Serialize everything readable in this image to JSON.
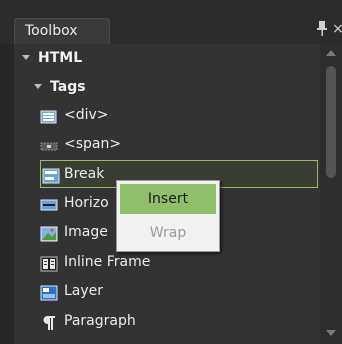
{
  "panel": {
    "tab_title": "Toolbox",
    "pin_icon": "pin-icon",
    "close_symbol": "×"
  },
  "tree": {
    "root": {
      "label": "HTML"
    },
    "group": {
      "label": "Tags"
    },
    "items": [
      {
        "label": "<div>",
        "icon": "div-icon"
      },
      {
        "label": "<span>",
        "icon": "span-icon"
      },
      {
        "label": "Break",
        "icon": "break-icon",
        "selected": true
      },
      {
        "label": "Horizo",
        "icon": "horizontal-rule-icon"
      },
      {
        "label": "Image",
        "icon": "image-icon"
      },
      {
        "label": "Inline Frame",
        "icon": "inline-frame-icon"
      },
      {
        "label": "Layer",
        "icon": "layer-icon"
      },
      {
        "label": "Paragraph",
        "icon": "paragraph-icon"
      }
    ]
  },
  "context_menu": {
    "items": [
      {
        "label": "Insert",
        "enabled": true,
        "highlighted": true
      },
      {
        "label": "Wrap",
        "enabled": false
      }
    ]
  },
  "colors": {
    "panel_bg": "#333333",
    "selection_border": "#9cba63",
    "menu_highlight": "#8fbf6b"
  }
}
